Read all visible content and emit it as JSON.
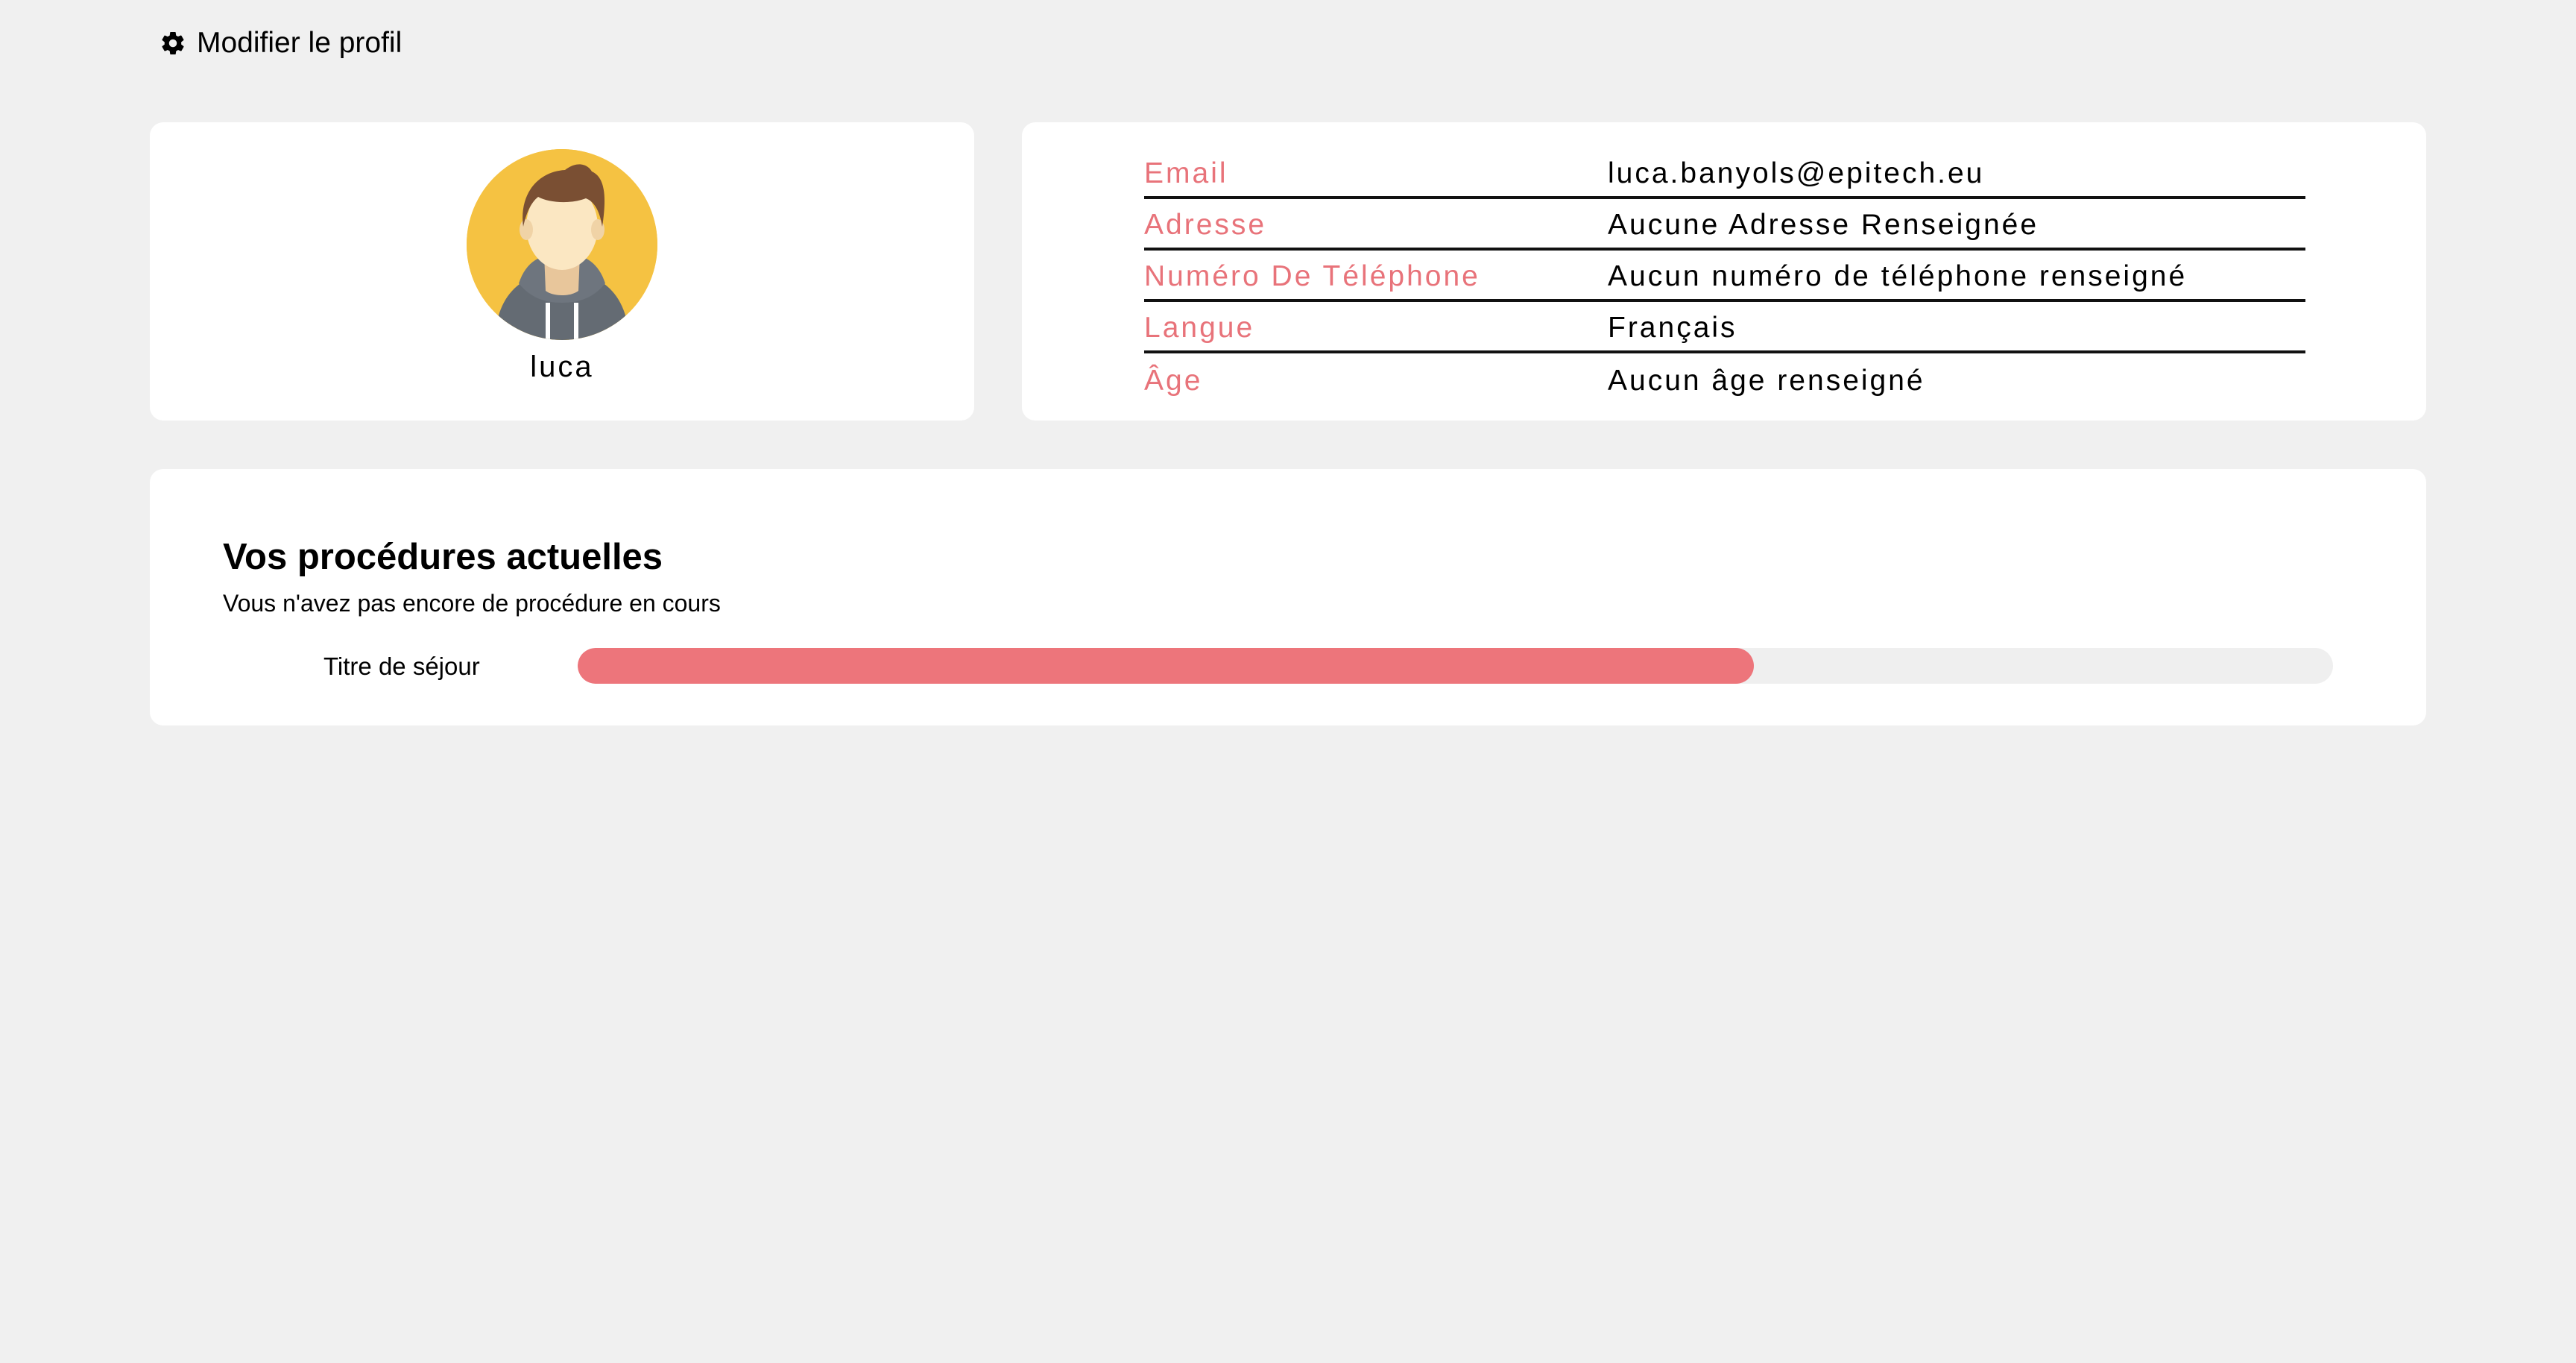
{
  "header": {
    "edit_profile_label": "Modifier le profil",
    "edit_profile_icon": "gear-icon"
  },
  "profile": {
    "username": "luca",
    "avatar_icon": "user-avatar",
    "avatar_bg": "#f5c242"
  },
  "info": {
    "rows": [
      {
        "label": "Email",
        "value": "luca.banyols@epitech.eu"
      },
      {
        "label": "Adresse",
        "value": "Aucune Adresse Renseignée"
      },
      {
        "label": "Numéro De Téléphone",
        "value": "Aucun numéro de téléphone renseigné"
      },
      {
        "label": "Langue",
        "value": "Français"
      },
      {
        "label": "Âge",
        "value": "Aucun âge renseigné"
      }
    ],
    "label_color": "#e8737a"
  },
  "procedures": {
    "title": "Vos procédures actuelles",
    "subtitle": "Vous n'avez pas encore de procédure en cours",
    "items": [
      {
        "name": "Titre de séjour",
        "progress": 0.67
      }
    ],
    "progress_color": "#ed757b",
    "track_color": "#efefef"
  }
}
